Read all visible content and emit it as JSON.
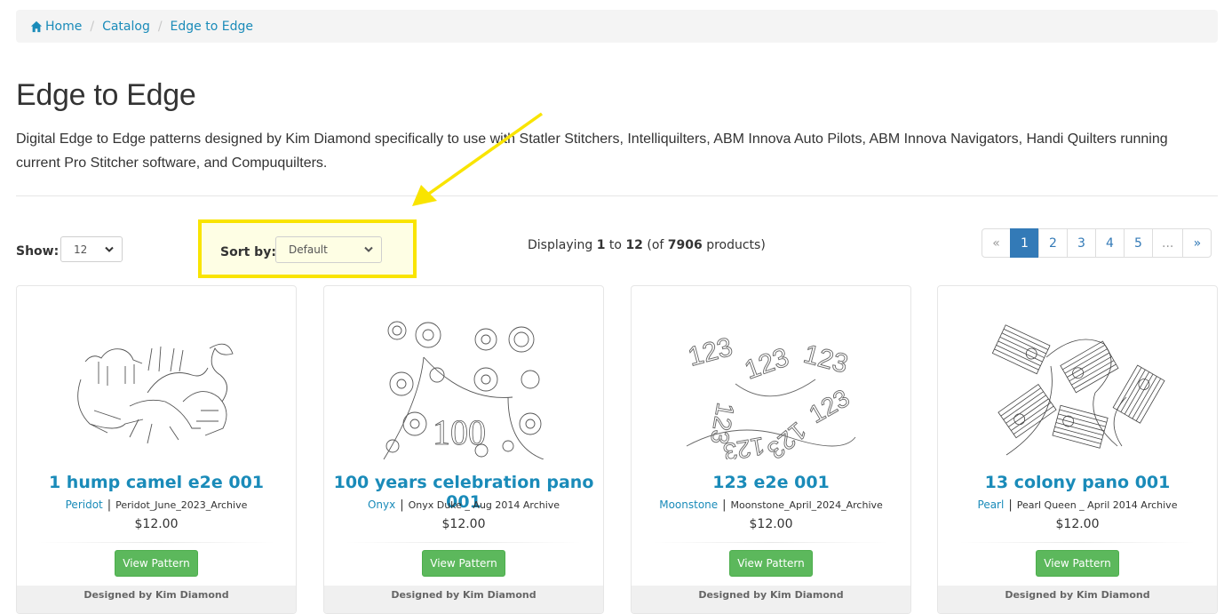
{
  "breadcrumb": [
    {
      "label": "Home",
      "icon": "home-icon"
    },
    {
      "label": "Catalog"
    },
    {
      "label": "Edge to Edge"
    }
  ],
  "page": {
    "title": "Edge to Edge",
    "description": "Digital Edge to Edge patterns designed by Kim Diamond specifically to use with Statler Stitchers, Intelliquilters, ABM Innova Auto Pilots, ABM Innova Navigators, Handi Quilters running current Pro Stitcher software, and Compuquilters."
  },
  "toolbar": {
    "show_label": "Show:",
    "show_value": "12",
    "sort_label": "Sort by:",
    "sort_value": "Default",
    "display_prefix": "Displaying ",
    "display_from": "1",
    "display_to_word": " to ",
    "display_to": "12",
    "display_of": " (of ",
    "display_total": "7906",
    "display_suffix": " products)"
  },
  "annotation": {
    "highlight_color": "#f9e400",
    "arrow_color": "#f9e400"
  },
  "pagination": {
    "prev": "«",
    "pages": [
      "1",
      "2",
      "3",
      "4",
      "5"
    ],
    "active": "1",
    "ellipsis": "...",
    "next": "»"
  },
  "products": [
    {
      "title": "1 hump camel e2e 001",
      "collection": "Peridot",
      "archive": "Peridot_June_2023_Archive",
      "price": "$12.00",
      "button": "View Pattern",
      "footer": "Designed by Kim Diamond",
      "image": "camel-pattern"
    },
    {
      "title": "100 years celebration pano 001",
      "collection": "Onyx",
      "archive": "Onyx Duke _ Aug 2014 Archive",
      "price": "$12.00",
      "button": "View Pattern",
      "footer": "Designed by Kim Diamond",
      "image": "floral-100-pattern"
    },
    {
      "title": "123 e2e 001",
      "collection": "Moonstone",
      "archive": "Moonstone_April_2024_Archive",
      "price": "$12.00",
      "button": "View Pattern",
      "footer": "Designed by Kim Diamond",
      "image": "numbers-123-pattern"
    },
    {
      "title": "13 colony pano 001",
      "collection": "Pearl",
      "archive": "Pearl Queen _ April 2014 Archive",
      "price": "$12.00",
      "button": "View Pattern",
      "footer": "Designed by Kim Diamond",
      "image": "colony-flags-pattern"
    }
  ],
  "colors": {
    "link": "#1a8bb9",
    "primary": "#337ab7",
    "success": "#5cb85c"
  }
}
